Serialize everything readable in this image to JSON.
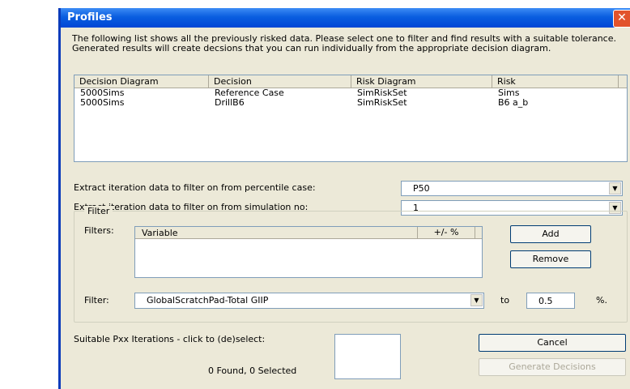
{
  "window": {
    "title": "Profiles",
    "close_glyph": "✕",
    "intro_text": "The following list shows all the previously risked data. Please select one to filter and find results with a suitable tolerance. Generated results will create decsions that you can run individually from the appropriate decision diagram."
  },
  "risk_list": {
    "columns": [
      "Decision Diagram",
      "Decision",
      "Risk Diagram",
      "Risk"
    ],
    "rows": [
      [
        "5000Sims",
        "Reference Case",
        "SimRiskSet",
        "Sims"
      ],
      [
        "5000Sims",
        "DrillB6",
        "SimRiskSet",
        "B6 a_b"
      ]
    ]
  },
  "percentile": {
    "label": "Extract iteration data to filter on from percentile case:",
    "value": "P50"
  },
  "simulation": {
    "label": "Extract iteration data to filter on from simulation no:",
    "value": "1"
  },
  "filter_group": {
    "title": "Filter",
    "filters_label": "Filters:",
    "columns": [
      "Variable",
      "+/- %"
    ],
    "add_label": "Add",
    "remove_label": "Remove",
    "filter_label": "Filter:",
    "filter_value": "GlobalScratchPad-Total GIIP",
    "to_label": "to",
    "tolerance_value": "0.5",
    "percent_label": "%."
  },
  "iterations": {
    "label": "Suitable Pxx Iterations - click to (de)select:",
    "status": "0 Found, 0 Selected"
  },
  "buttons": {
    "cancel_label": "Cancel",
    "generate_label": "Generate Decisions"
  },
  "icons": {
    "dropdown": "chevron-down-icon"
  }
}
